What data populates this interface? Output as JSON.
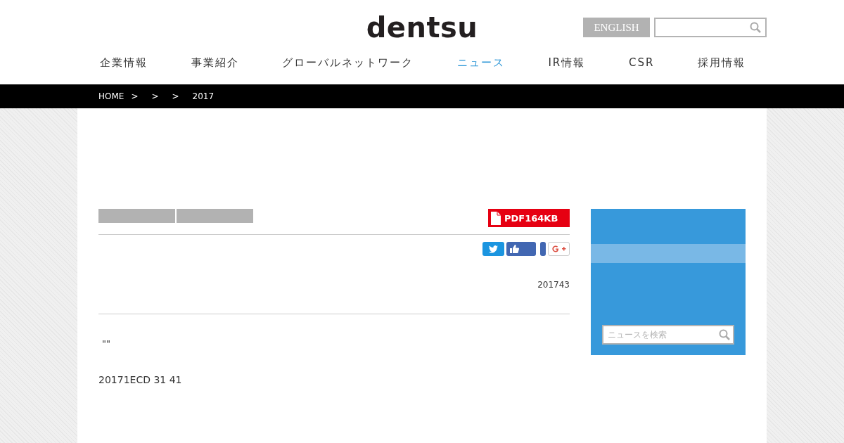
{
  "header": {
    "logo": "dentsu",
    "language_button": "ENGLISH"
  },
  "nav": [
    {
      "label": "企業情報",
      "selected": false
    },
    {
      "label": "事業紹介",
      "selected": false
    },
    {
      "label": "グローバルネットワーク",
      "selected": false
    },
    {
      "label": "ニュース",
      "selected": true
    },
    {
      "label": "IR情報",
      "selected": false
    },
    {
      "label": "CSR",
      "selected": false
    },
    {
      "label": "採用情報",
      "selected": false
    }
  ],
  "breadcrumb": [
    "HOME",
    ">",
    ">",
    ">",
    "2017"
  ],
  "article": {
    "pdf_link": "PDF164KB",
    "date": "201743",
    "quote": "\"\"",
    "body": "20171ECD 31 41"
  },
  "sidebar": {
    "search": {
      "placeholder": "ニュースを検索"
    }
  }
}
